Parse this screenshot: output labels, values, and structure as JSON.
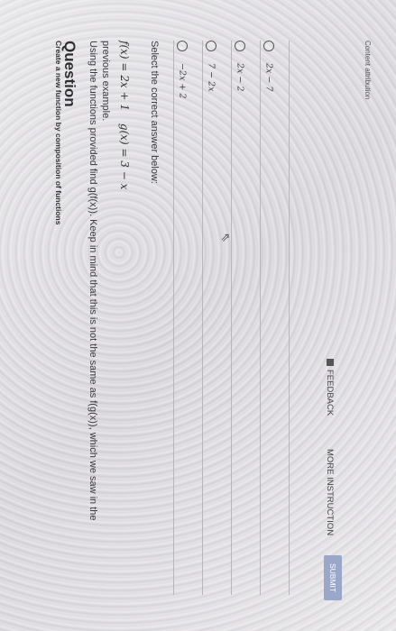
{
  "header": {
    "subtitle": "Create a new function by composition of functions",
    "title": "Question"
  },
  "question": {
    "line1": "Using the functions provided find g(f(x)). Keep in mind that this is not the same as f(g(x)), which we saw in the",
    "line2": "previous example.",
    "f_def": "f(x) = 2x + 1",
    "g_def": "g(x) = 3 − x",
    "prompt": "Select the correct answer below:"
  },
  "options": [
    {
      "label": "−2x + 2"
    },
    {
      "label": "7 − 2x"
    },
    {
      "label": "2x − 2"
    },
    {
      "label": "2x − 7"
    }
  ],
  "footer": {
    "feedback": "FEEDBACK",
    "more": "MORE INSTRUCTION",
    "submit": "SUBMIT",
    "attribution": "Content attribution"
  },
  "icons": {
    "radio": "radio-empty-icon",
    "feedback": "feedback-icon",
    "cursor": "mouse-pointer-icon"
  }
}
